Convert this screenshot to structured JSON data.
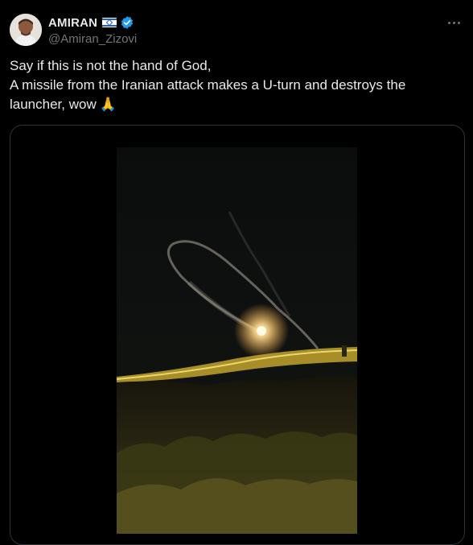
{
  "author": {
    "display_name": "AMIRAN",
    "flag_icon": "israel-flag-icon",
    "verified_icon": "verified-badge-icon",
    "handle": "@Amiran_Zizovi"
  },
  "menu": {
    "more_icon": "more-horizontal-icon"
  },
  "tweet": {
    "line1": "Say if this is not the hand of God,",
    "line2": "A missile from the Iranian attack makes a U-turn and destroys the",
    "line3": "launcher, wow",
    "emoji": "🙏"
  },
  "media": {
    "type": "video",
    "description_icon": "video-frame"
  },
  "colors": {
    "background": "#000000",
    "text": "#e7e9ea",
    "muted": "#71767b",
    "verified": "#1d9bf0",
    "border": "#2f3336"
  }
}
